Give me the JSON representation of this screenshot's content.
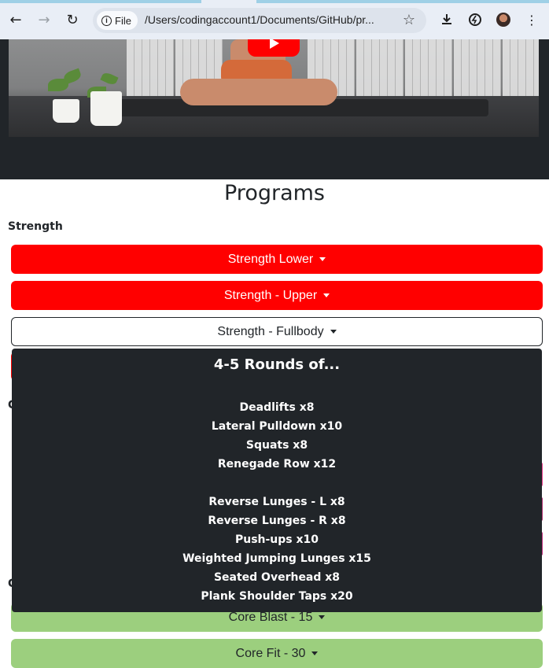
{
  "browser": {
    "file_chip": "File",
    "url": "/Users/codingaccount1/Documents/GitHub/pr..."
  },
  "page": {
    "title": "Programs",
    "sections": {
      "strength": "Strength",
      "cardio_partial": "C",
      "core_partial": "C"
    },
    "buttons": {
      "strength_lower": "Strength Lower",
      "strength_upper": "Strength - Upper",
      "strength_fullbody": "Strength - Fullbody",
      "core_blast": "Core Blast - 15",
      "core_fit": "Core Fit - 30"
    },
    "dropdown": {
      "heading": "4-5 Rounds of...",
      "items": [
        "Deadlifts x8",
        "Lateral Pulldown x10",
        "Squats x8",
        "Renegade Row x12",
        "Reverse Lunges - L x8",
        "Reverse Lunges - R x8",
        "Push-ups x10",
        "Weighted Jumping Lunges x15",
        "Seated Overhead x8",
        "Plank Shoulder Taps x20"
      ]
    }
  },
  "colors": {
    "red_button": "#ff0000",
    "green_button": "#9ccf7e",
    "dark_panel": "#212529",
    "pink_hint": "#e83e8c"
  }
}
